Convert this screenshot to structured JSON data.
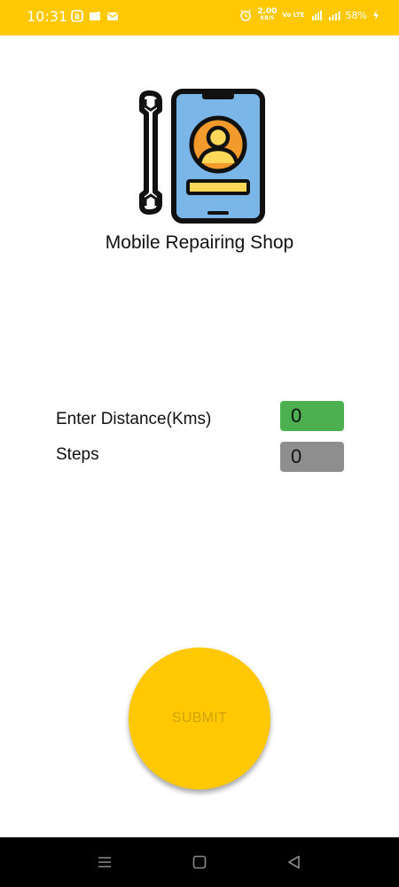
{
  "status_bar": {
    "time": "10:31",
    "network_speed": "2.00",
    "network_speed_unit": "KB/S",
    "volte": "Vo LTE",
    "battery": "58%",
    "background": "#FFC800"
  },
  "app": {
    "title": "Mobile Repairing Shop",
    "logo_icon": "phone-repair-icon"
  },
  "form": {
    "distance_label": "Enter Distance(Kms)",
    "distance_value": "0",
    "distance_color": "#4CAF50",
    "steps_label": "Steps",
    "steps_value": "0",
    "steps_color": "#8E8E8E"
  },
  "submit": {
    "label": "SUBMIT",
    "color": "#FFC800"
  },
  "nav": {
    "icons": [
      "menu-icon",
      "home-icon",
      "back-icon"
    ]
  }
}
